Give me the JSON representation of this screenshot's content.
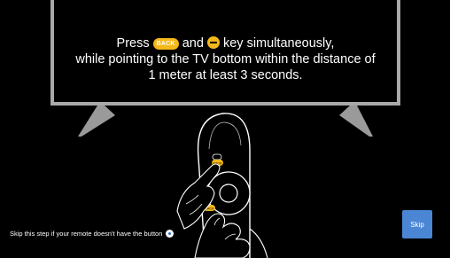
{
  "instruction": {
    "press_text": "Press",
    "back_key_label": "BACK",
    "and_text": "and",
    "key_text": "key simultaneously,",
    "line2": "while pointing to the TV bottom within the distance of",
    "line3": "1 meter at least 3 seconds."
  },
  "remote_illustration": {
    "button_top_label": "BACK",
    "button_bottom_label": "BACK"
  },
  "skip_note": {
    "text": "Skip this step if your remote doesn't have the button",
    "icon": "remote-button-icon"
  },
  "skip_button": {
    "label": "Skip"
  },
  "colors": {
    "background": "#000000",
    "tv_frame": "#a9a9a9",
    "key_accent": "#f5b81a",
    "skip_button": "#4a86d4"
  }
}
